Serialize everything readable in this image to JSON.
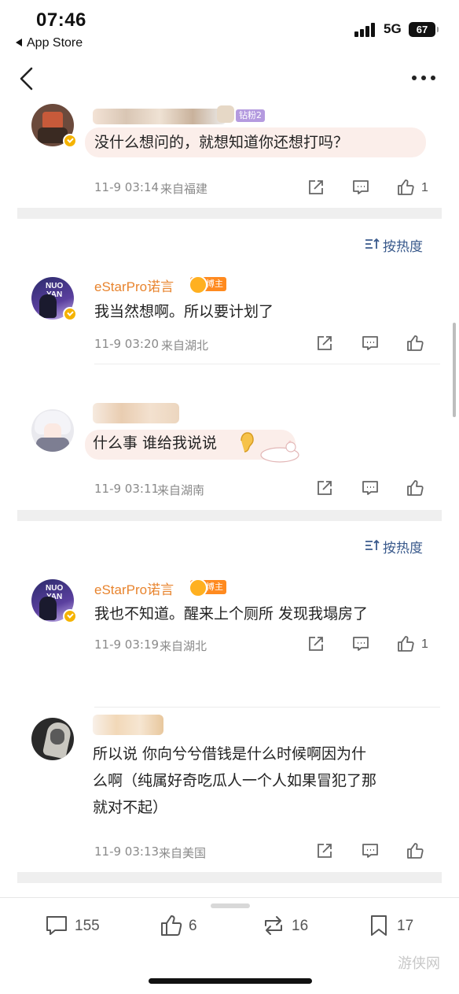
{
  "status_bar": {
    "time": "07:46",
    "back_app": "App Store",
    "network": "5G",
    "battery": "67"
  },
  "comments": [
    {
      "author_tag": "钻粉2",
      "text": "没什么想问的，就想知道你还想打吗？",
      "time": "11-9 03:14",
      "location": "来自福建",
      "likes": "1",
      "replies": [
        {
          "author": "eStarPro诺言",
          "tag": "博主",
          "text": "我当然想啊。所以要计划了",
          "time": "11-9 03:20",
          "location": "来自湖北"
        }
      ]
    },
    {
      "text": "什么事 谁给我说说",
      "time": "11-9 03:11",
      "location": "来自湖南",
      "replies": [
        {
          "author": "eStarPro诺言",
          "tag": "博主",
          "text": "我也不知道。醒来上个厕所 发现我塌房了",
          "time": "11-9 03:19",
          "location": "来自湖北",
          "likes": "1"
        }
      ]
    },
    {
      "text_lines": [
        "所以说 你向兮兮借钱是什么时候啊因为什",
        "么啊（纯属好奇吃瓜人一个人如果冒犯了那",
        "就对不起）"
      ],
      "time": "11-9 03:13",
      "location": "来自美国"
    }
  ],
  "sort_label": "按热度",
  "avatar_text": {
    "line1": "NUO",
    "line2": "YAN"
  },
  "bottom_bar": {
    "comments": "155",
    "likes": "6",
    "reposts": "16",
    "favorites": "17"
  },
  "watermark": "游侠网",
  "colors": {
    "accent_orange": "#e8842e",
    "sort_blue": "#3a5a8c",
    "separator": "#efefef",
    "bubble": "#fbeeea"
  }
}
